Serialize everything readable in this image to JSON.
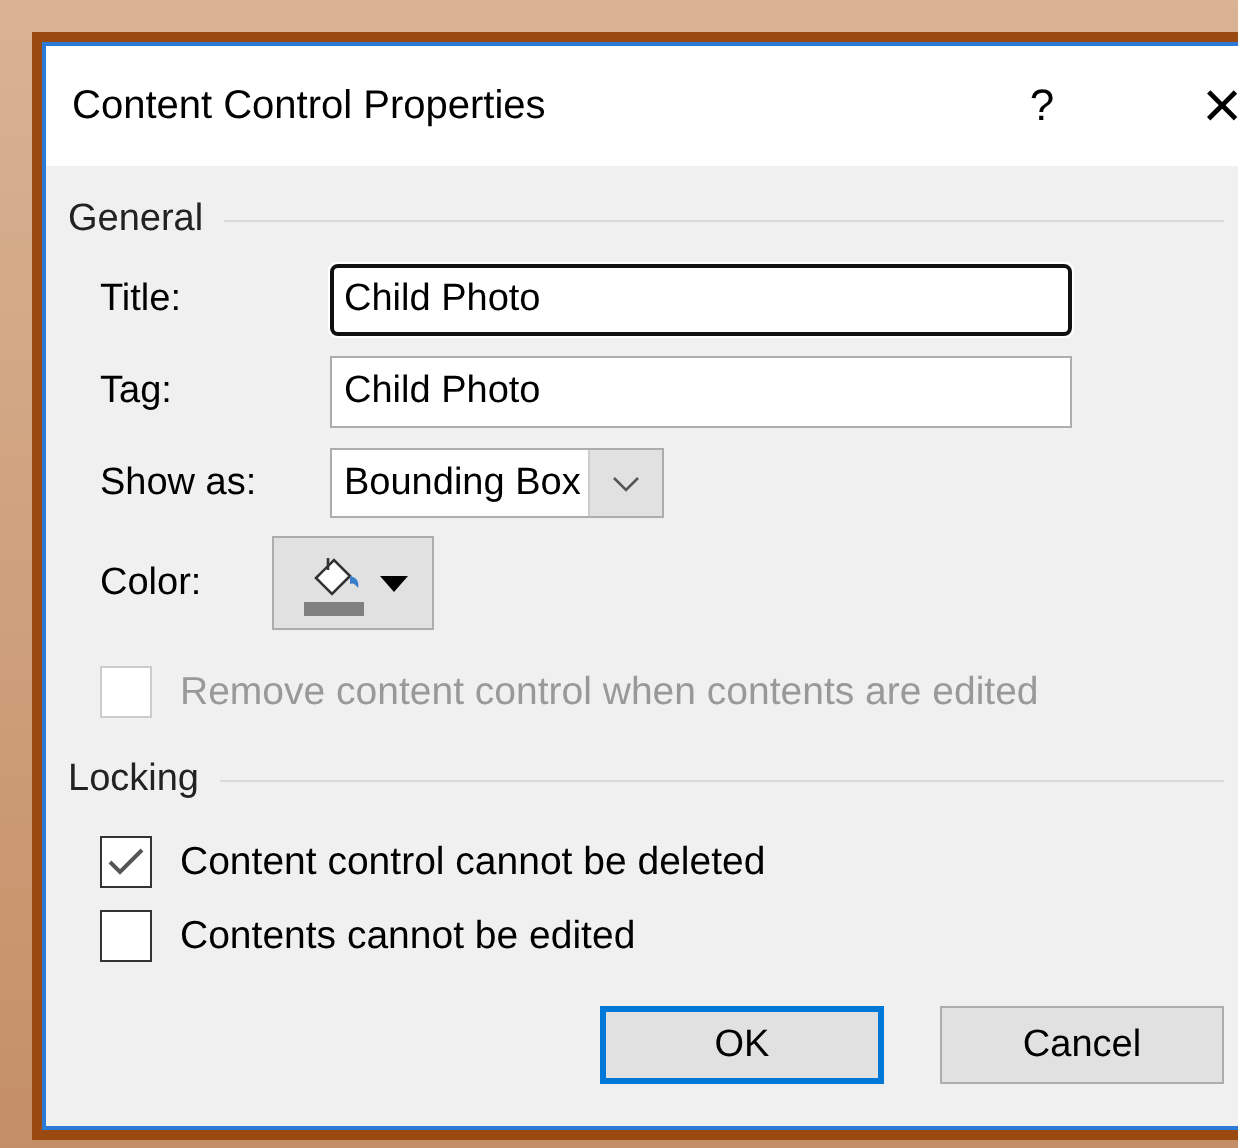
{
  "window": {
    "title": "Content Control Properties",
    "help": "?",
    "close": "×"
  },
  "general": {
    "heading": "General",
    "fields": [
      {
        "label": "Title:",
        "value": "Child Photo",
        "focused": true
      },
      {
        "label": "Tag:",
        "value": "Child Photo",
        "focused": false
      }
    ],
    "show_as": {
      "label": "Show as:",
      "value": "Bounding Box"
    },
    "color": {
      "label": "Color:"
    },
    "remove_option": {
      "label": "Remove content control when contents are edited",
      "checked": false,
      "disabled": true
    }
  },
  "locking": {
    "heading": "Locking",
    "options": [
      {
        "label": "Content control cannot be deleted",
        "checked": true,
        "disabled": false
      },
      {
        "label": "Contents cannot be edited",
        "checked": false,
        "disabled": false
      }
    ]
  },
  "buttons": [
    {
      "label": "OK",
      "default": true
    },
    {
      "label": "Cancel",
      "default": false
    }
  ]
}
